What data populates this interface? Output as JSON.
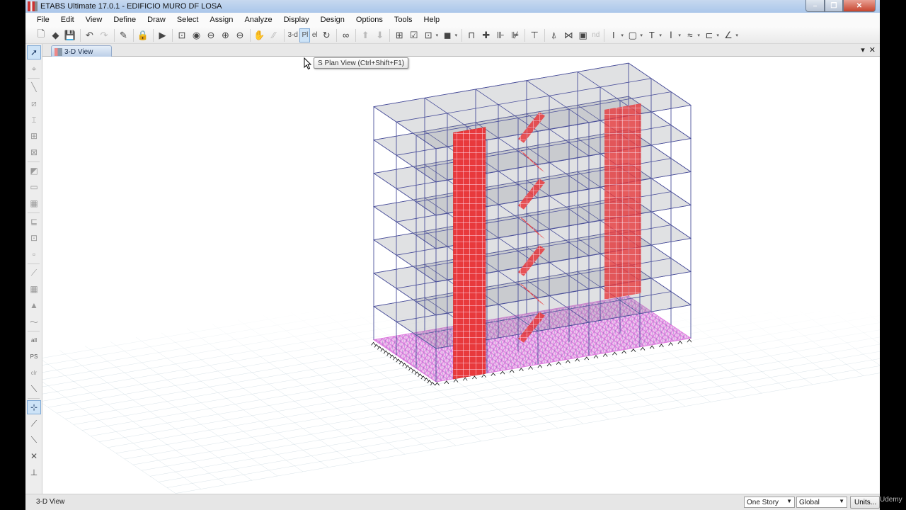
{
  "window": {
    "title": "ETABS Ultimate 17.0.1 - EDIFICIO MURO DF LOSA",
    "controls": {
      "minimize": "–",
      "maximize": "❐",
      "close": "✕"
    }
  },
  "menubar": [
    "File",
    "Edit",
    "View",
    "Define",
    "Draw",
    "Select",
    "Assign",
    "Analyze",
    "Display",
    "Design",
    "Options",
    "Tools",
    "Help"
  ],
  "toolbar": {
    "items": [
      {
        "icon": "new-file-icon",
        "glyph": "🗋"
      },
      {
        "icon": "open-icon",
        "glyph": "◆"
      },
      {
        "icon": "save-icon",
        "glyph": "💾"
      },
      {
        "sep": true
      },
      {
        "icon": "undo-icon",
        "glyph": "↶"
      },
      {
        "icon": "redo-icon",
        "glyph": "↷",
        "gray": true
      },
      {
        "sep": true
      },
      {
        "icon": "pencil-icon",
        "glyph": "✎"
      },
      {
        "sep": true
      },
      {
        "icon": "lock-icon",
        "glyph": "🔒"
      },
      {
        "sep": true
      },
      {
        "icon": "run-analysis-icon",
        "glyph": "▶"
      },
      {
        "sep": true
      },
      {
        "icon": "zoom-window-icon",
        "glyph": "⊡"
      },
      {
        "icon": "zoom-restore-icon",
        "glyph": "◉"
      },
      {
        "icon": "zoom-previous-icon",
        "glyph": "⊖"
      },
      {
        "icon": "zoom-in-icon",
        "glyph": "⊕"
      },
      {
        "icon": "zoom-out-icon",
        "glyph": "⊖"
      },
      {
        "sep": true
      },
      {
        "icon": "pan-icon",
        "glyph": "✋"
      },
      {
        "icon": "measure-icon",
        "glyph": "⁄⁄",
        "gray": true
      },
      {
        "sep": true
      },
      {
        "icon": "3d-view-icon",
        "text": "3-d"
      },
      {
        "icon": "plan-view-icon",
        "text": "Pl",
        "selected": true
      },
      {
        "icon": "elevation-view-icon",
        "text": "el"
      },
      {
        "icon": "rotate-view-icon",
        "glyph": "↻"
      },
      {
        "sep": true
      },
      {
        "icon": "perspective-icon",
        "glyph": "∞"
      },
      {
        "sep": true
      },
      {
        "icon": "move-up-icon",
        "glyph": "⬆",
        "gray": true
      },
      {
        "icon": "move-down-icon",
        "glyph": "⬇",
        "gray": true
      },
      {
        "sep": true
      },
      {
        "icon": "object-shrink-icon",
        "glyph": "⊞"
      },
      {
        "icon": "set-display-options-icon",
        "glyph": "☑"
      },
      {
        "icon": "building-view-icon",
        "glyph": "⊡",
        "dropdown": true
      },
      {
        "icon": "view-options-icon",
        "glyph": "◼",
        "dropdown": true
      },
      {
        "sep": true
      },
      {
        "icon": "draw-frame-icon",
        "glyph": "⊓"
      },
      {
        "icon": "joint-icon",
        "glyph": "✚"
      },
      {
        "icon": "elevation-grid-icon",
        "glyph": "⊪"
      },
      {
        "icon": "loads-icon",
        "glyph": "⊯"
      },
      {
        "sep": true
      },
      {
        "icon": "column-icon",
        "glyph": "⊤"
      },
      {
        "sep": true
      },
      {
        "icon": "support-icon",
        "glyph": "⍋"
      },
      {
        "icon": "link-icon",
        "glyph": "⋈"
      },
      {
        "icon": "shell-display-icon",
        "glyph": "▣"
      },
      {
        "icon": "nd-icon",
        "text": "nd",
        "gray": true
      },
      {
        "sep": true
      },
      {
        "icon": "beam-section-icon",
        "glyph": "I",
        "dropdown": true
      },
      {
        "icon": "slab-section-icon",
        "glyph": "▢",
        "dropdown": true
      },
      {
        "icon": "t-section-icon",
        "glyph": "T",
        "dropdown": true
      },
      {
        "icon": "i-section-icon",
        "glyph": "Ⅰ",
        "dropdown": true
      },
      {
        "icon": "deck-section-icon",
        "glyph": "≈",
        "dropdown": true
      },
      {
        "icon": "c-section-icon",
        "glyph": "⊏",
        "dropdown": true
      },
      {
        "icon": "draw-tool-icon",
        "glyph": "∠",
        "dropdown": true
      }
    ]
  },
  "left_toolbar": [
    {
      "icon": "select-pointer-icon",
      "glyph": "➚",
      "selected": true
    },
    {
      "icon": "reshape-icon",
      "glyph": "⌖"
    },
    {
      "sep": true
    },
    {
      "icon": "draw-line-icon",
      "glyph": "╲"
    },
    {
      "icon": "draw-frame-rect-icon",
      "glyph": "⧄"
    },
    {
      "icon": "draw-beam-icon",
      "glyph": "⌶"
    },
    {
      "icon": "draw-braces-icon",
      "glyph": "⊞"
    },
    {
      "icon": "draw-cross-braces-icon",
      "glyph": "⊠"
    },
    {
      "sep": true
    },
    {
      "icon": "draw-floor-poly-icon",
      "glyph": "◩"
    },
    {
      "icon": "draw-floor-rect-icon",
      "glyph": "▭"
    },
    {
      "icon": "draw-floor-click-icon",
      "glyph": "▦"
    },
    {
      "sep": true
    },
    {
      "icon": "draw-wall-icon",
      "glyph": "⊑"
    },
    {
      "icon": "draw-wall-stack-icon",
      "glyph": "⊡"
    },
    {
      "icon": "draw-opening-icon",
      "glyph": "▫"
    },
    {
      "sep": true
    },
    {
      "icon": "draw-link-icon",
      "glyph": "⟋"
    },
    {
      "icon": "draw-grid-icon",
      "glyph": "▦"
    },
    {
      "icon": "draw-tendon-icon",
      "glyph": "▲"
    },
    {
      "icon": "draw-wave-icon",
      "glyph": "〜"
    },
    {
      "sep": true
    },
    {
      "icon": "select-all-icon",
      "text": "all",
      "dark": true
    },
    {
      "icon": "select-ps-icon",
      "text": "PS",
      "dark": true
    },
    {
      "icon": "clear-selection-icon",
      "text": "clr"
    },
    {
      "icon": "select-intersect-icon",
      "glyph": "⟍",
      "dark": true
    },
    {
      "sep": true
    },
    {
      "icon": "snap-points-icon",
      "glyph": "⊹",
      "selected": true
    },
    {
      "icon": "snap-ends-icon",
      "glyph": "⟋",
      "dark": true
    },
    {
      "icon": "snap-perpendicular-icon",
      "glyph": "⟍",
      "dark": true
    },
    {
      "icon": "snap-intersect-icon",
      "glyph": "✕",
      "dark": true
    },
    {
      "icon": "snap-more-icon",
      "glyph": "⊥",
      "dark": true
    }
  ],
  "tabs": [
    {
      "label": "3-D View",
      "active": true
    }
  ],
  "tab_controls": {
    "dropdown": "▾",
    "close": "✕"
  },
  "tooltip": {
    "text": "Set Plan View (Ctrl+Shift+F1)",
    "visible_text": "S Plan View (Ctrl+Shift+F1)"
  },
  "model": {
    "stories": 7,
    "colors": {
      "frame": "#4a4f9a",
      "slab_fill": "#8e929c",
      "shear_wall": "#e8393c",
      "base_mesh": "#e07be0",
      "ground_grid": "#b9ccd6",
      "supports": "#111111"
    }
  },
  "statusbar": {
    "text": "3-D View",
    "story_select": "One Story",
    "coord_select": "Global",
    "units_button": "Units..."
  },
  "watermark": "Udemy"
}
